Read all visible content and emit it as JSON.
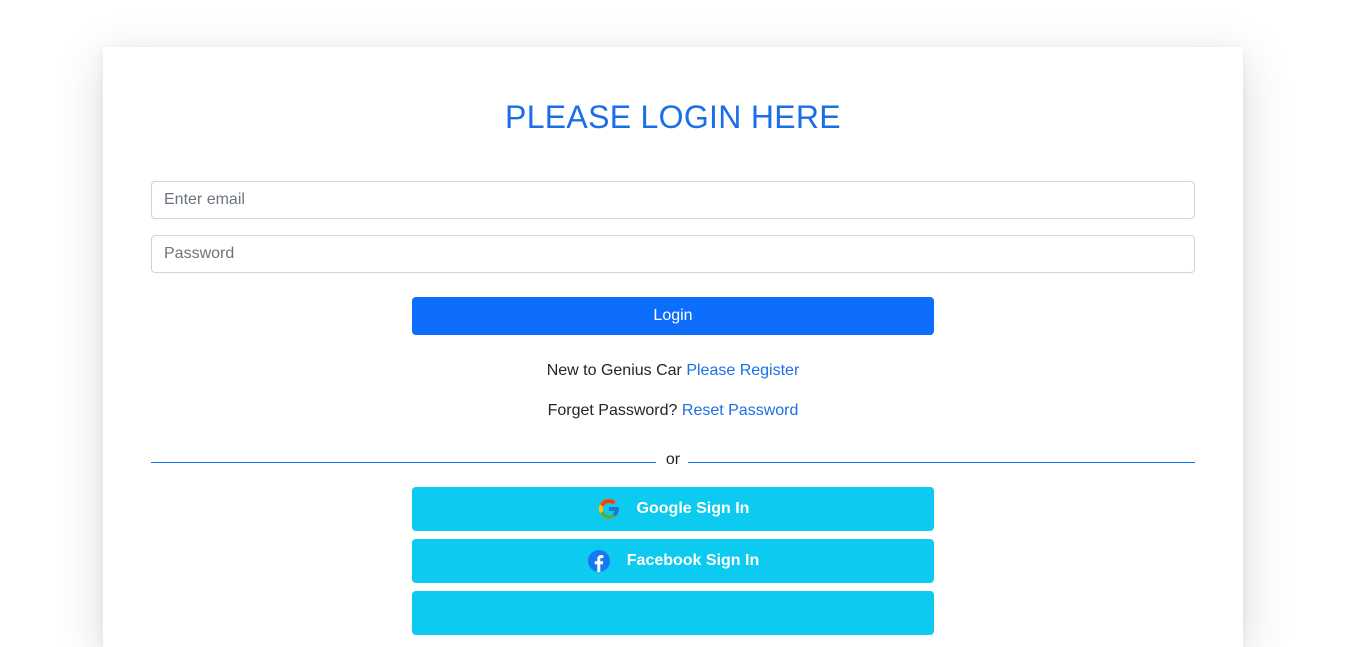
{
  "login": {
    "title": "PLEASE LOGIN HERE",
    "email_placeholder": "Enter email",
    "password_placeholder": "Password",
    "login_button": "Login",
    "register_prompt": "New to Genius Car",
    "register_link": "Please Register",
    "reset_prompt": "Forget Password?",
    "reset_link": "Reset Password",
    "divider_text": "or"
  },
  "social": {
    "google_label": "Google Sign In",
    "google_icon": "google-icon",
    "facebook_label": "Facebook Sign In",
    "facebook_icon": "facebook-icon"
  },
  "colors": {
    "title": "#1a6fe8",
    "primary_button": "#0d6efd",
    "social_button": "#0dcaf0",
    "divider": "#0d6efd"
  }
}
